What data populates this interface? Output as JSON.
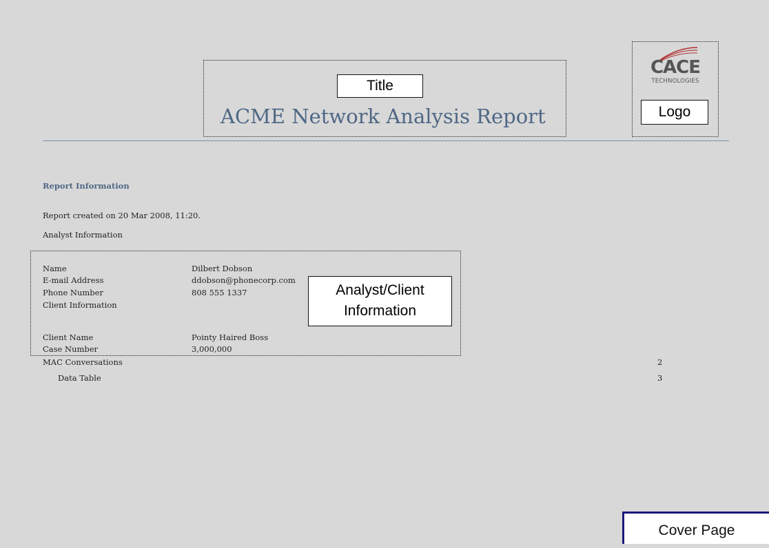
{
  "header": {
    "title_callout": "Title",
    "report_title": "ACME Network Analysis Report",
    "logo_callout": "Logo",
    "logo_brand": "CACE",
    "logo_sub": "TECHNOLOGIES"
  },
  "report_info": {
    "heading": "Report Information",
    "created": "Report created on 20 Mar 2008, 11:20.",
    "analyst_heading": "Analyst Information"
  },
  "analyst": {
    "name_label": "Name",
    "name_value": "Dilbert Dobson",
    "email_label": "E-mail Address",
    "email_value": "ddobson@phonecorp.com",
    "phone_label": "Phone Number",
    "phone_value": "808 555 1337",
    "client_info_label": "Client Information",
    "client_name_label": "Client Name",
    "client_name_value": "Pointy Haired Boss",
    "case_number_label": "Case Number",
    "case_number_value": "3,000,000",
    "callout_line1": "Analyst/Client",
    "callout_line2": "Information"
  },
  "toc": [
    {
      "label": "MAC Conversations",
      "page": "2"
    },
    {
      "label": "Data Table",
      "page": "3"
    }
  ],
  "tab_label": "Cover Page",
  "colors": {
    "accent": "#4f6785",
    "background": "#d8d8d8",
    "tab_border": "#1a1a7a"
  }
}
